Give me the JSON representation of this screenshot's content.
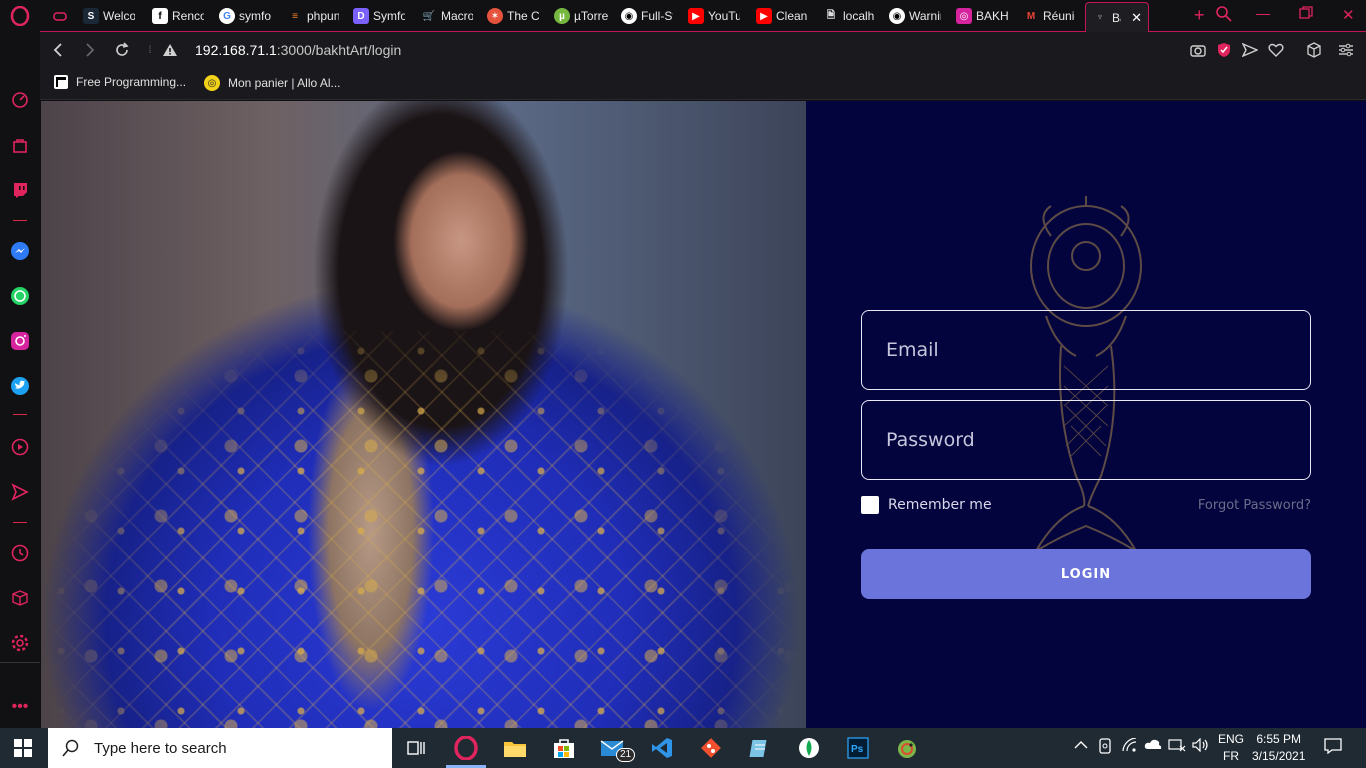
{
  "browser": {
    "tabs": [
      {
        "label": "Welco",
        "icon": "steam-icon"
      },
      {
        "label": "Renco",
        "icon": "f-icon"
      },
      {
        "label": "symfo",
        "icon": "google-icon"
      },
      {
        "label": "phpun",
        "icon": "stackoverflow-icon"
      },
      {
        "label": "Symfo",
        "icon": "symfony-icon"
      },
      {
        "label": "Macro",
        "icon": "cart-icon"
      },
      {
        "label": "The Cr",
        "icon": "thecr-icon"
      },
      {
        "label": "µTorre",
        "icon": "utorrent-icon"
      },
      {
        "label": "Full-St",
        "icon": "github-icon"
      },
      {
        "label": "YouTu",
        "icon": "youtube-icon"
      },
      {
        "label": "Clean",
        "icon": "youtube-icon"
      },
      {
        "label": "localh",
        "icon": "file-icon"
      },
      {
        "label": "Warnir",
        "icon": "github-icon"
      },
      {
        "label": "BAKH",
        "icon": "instagram-icon"
      },
      {
        "label": "Réunic",
        "icon": "gmail-icon"
      },
      {
        "label": "Ba",
        "icon": "bakht-icon",
        "active": true
      }
    ],
    "url_host": "192.168.71.1",
    "url_path": ":3000/bakhtArt/login",
    "bookmarks": [
      {
        "label": "Free Programming...",
        "icon": "book-icon"
      },
      {
        "label": "Mon panier | Allo Al...",
        "icon": "allo-icon"
      }
    ]
  },
  "login": {
    "email_placeholder": "Email",
    "password_placeholder": "Password",
    "remember_label": "Remember me",
    "forgot_label": "Forgot Password?",
    "login_button": "LOGIN"
  },
  "taskbar": {
    "search_placeholder": "Type here to search",
    "mail_badge": "21",
    "lang_top": "ENG",
    "lang_bottom": "FR",
    "time": "6:55 PM",
    "date": "3/15/2021"
  },
  "colors": {
    "page_bg": "#03033d",
    "button_bg": "#6a74db",
    "opera_accent": "#e0245e"
  }
}
